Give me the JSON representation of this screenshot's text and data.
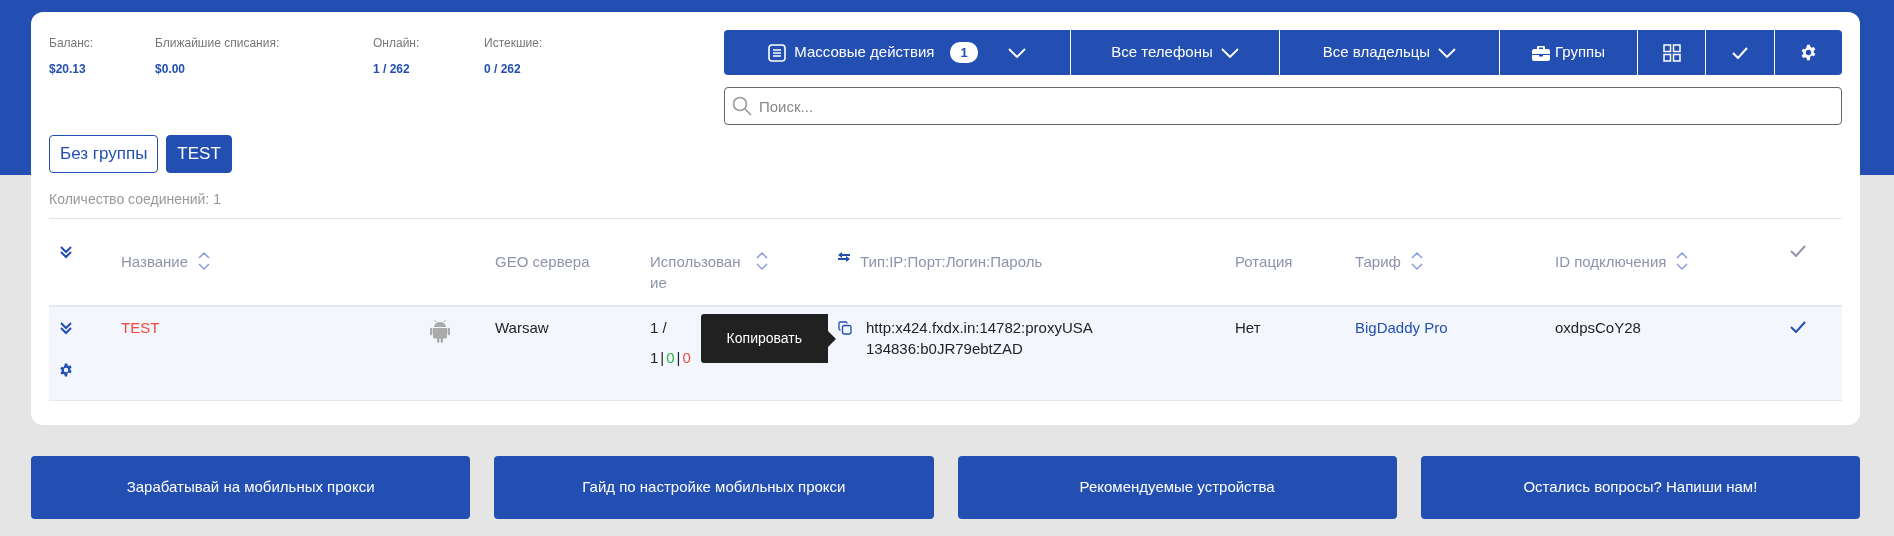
{
  "stats": [
    {
      "label": "Баланс:",
      "value": "$20.13"
    },
    {
      "label": "Ближайшие списания:",
      "value": "$0.00"
    },
    {
      "label": "Онлайн:",
      "value": "1 / 262"
    },
    {
      "label": "Истекшие:",
      "value": "0 / 262"
    }
  ],
  "toolbar": {
    "mass_actions": {
      "label": "Массовые действия",
      "count": "1"
    },
    "filters": [
      {
        "label": "Все телефоны"
      },
      {
        "label": "Все владельцы"
      }
    ],
    "groups_button": {
      "label": "Группы"
    }
  },
  "search": {
    "placeholder": "Поиск..."
  },
  "groups": [
    {
      "label": "Без группы",
      "selected": false
    },
    {
      "label": "TEST",
      "selected": true
    }
  ],
  "connection_count": "Количество соединений: 1",
  "table": {
    "columns": [
      {
        "kind": "expand"
      },
      {
        "kind": "text",
        "label": "Название",
        "sortable": true
      },
      {
        "kind": "blank"
      },
      {
        "kind": "text",
        "label": "GEO сервера",
        "sortable": false
      },
      {
        "kind": "text",
        "label": "Использование",
        "sortable": true
      },
      {
        "kind": "proxy",
        "label": "Тип:IP:Порт:Логин:Пароль",
        "sortable": false
      },
      {
        "kind": "text",
        "label": "Ротация",
        "sortable": false
      },
      {
        "kind": "text",
        "label": "Тариф",
        "sortable": true
      },
      {
        "kind": "text",
        "label": "ID подключения",
        "sortable": true
      },
      {
        "kind": "check"
      }
    ],
    "rows": [
      {
        "name": "TEST",
        "color": "#f0483e",
        "geo": "Warsaw",
        "usage": "1 /",
        "counts": [
          {
            "text": "1",
            "color": "#212529"
          },
          {
            "text": "0",
            "color": "#28b44a"
          },
          {
            "text": "0",
            "color": "#f0483e"
          }
        ],
        "counts_separator": "|",
        "proxy_lines": [
          "http:x424.fxdx.in:14782:proxyUSA",
          "134836:b0JR79ebtZAD"
        ],
        "rotation": "Нет",
        "tariff": "BigDaddy Pro",
        "connection_id": "oxdpsCoY28",
        "selected": true
      }
    ]
  },
  "tooltip": {
    "text": "Копировать"
  },
  "footer_buttons": [
    {
      "label": "Зарабатывай на мобильных прокси"
    },
    {
      "label": "Гайд по настройке мобильных прокси"
    },
    {
      "label": "Рекомендуемые устройства"
    },
    {
      "label": "Остались вопросы? Напиши нам!"
    }
  ]
}
